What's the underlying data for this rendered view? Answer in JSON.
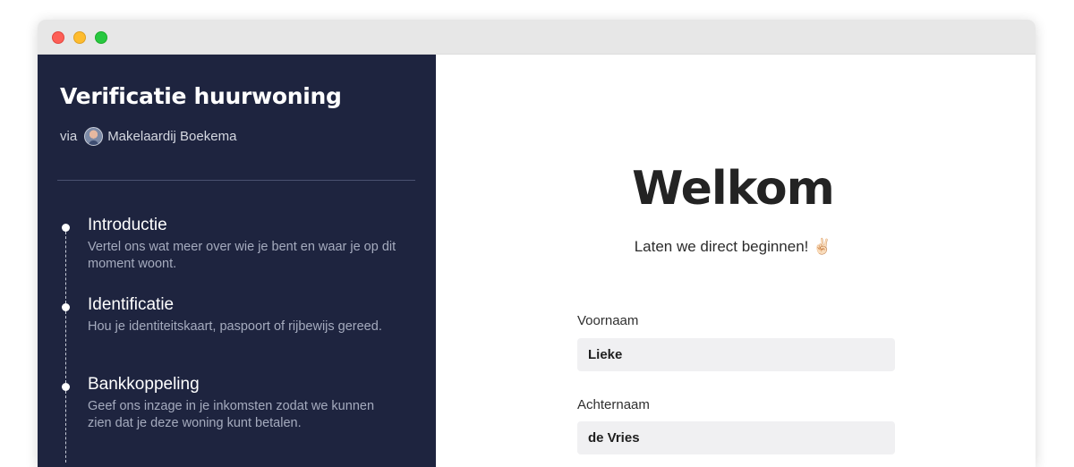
{
  "window": {
    "buttons": [
      "close",
      "minimize",
      "maximize"
    ]
  },
  "sidebar": {
    "title": "Verificatie huurwoning",
    "via_label": "via",
    "company": "Makelaardij Boekema",
    "steps": [
      {
        "title": "Introductie",
        "description": "Vertel ons wat meer over wie je bent en waar je op dit moment woont."
      },
      {
        "title": "Identificatie",
        "description": "Hou je identiteitskaart, paspoort of rijbewijs gereed."
      },
      {
        "title": "Bankkoppeling",
        "description": "Geef ons inzage in je inkomsten zodat we kunnen zien dat je deze woning kunt betalen."
      }
    ]
  },
  "main": {
    "heading": "Welkom",
    "subtitle": "Laten we direct beginnen! ✌🏻",
    "fields": {
      "first_name": {
        "label": "Voornaam",
        "value": "Lieke"
      },
      "last_name": {
        "label": "Achternaam",
        "value": "de Vries"
      }
    }
  },
  "colors": {
    "sidebar_bg": "#1e243f",
    "input_bg": "#f0f0f2",
    "heading": "#232323"
  }
}
